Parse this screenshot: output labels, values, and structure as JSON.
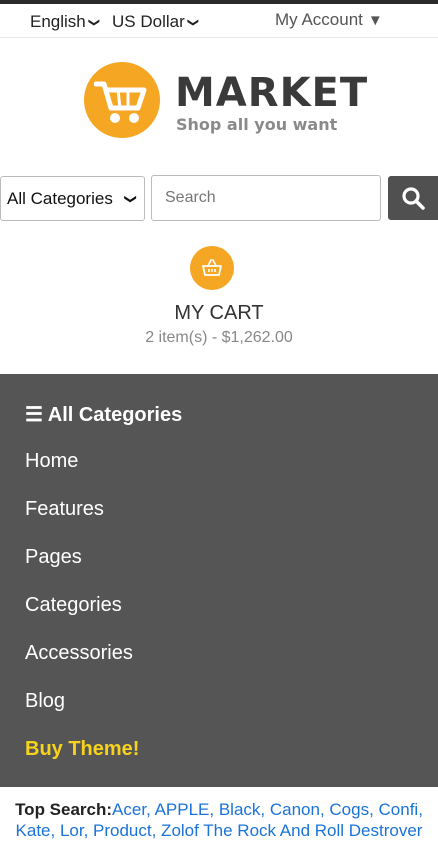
{
  "topbar": {
    "language": "English",
    "currency": "US Dollar",
    "account": "My Account",
    "account_arrow": "▼"
  },
  "logo": {
    "title": "MARKET",
    "tagline": "Shop all you want",
    "icon": "shopping-cart-icon",
    "color": "#f5a623"
  },
  "search": {
    "category": "All Categories",
    "placeholder": "Search",
    "button_icon": "search-icon"
  },
  "cart": {
    "icon": "basket-icon",
    "title": "MY CART",
    "summary": "2 item(s) - $1,262.00"
  },
  "menu": {
    "background": "#555555",
    "header": "☰ All Categories",
    "items": [
      {
        "label": "Home"
      },
      {
        "label": "Features"
      },
      {
        "label": "Pages"
      },
      {
        "label": "Categories"
      },
      {
        "label": "Accessories"
      },
      {
        "label": "Blog"
      }
    ],
    "buy": "Buy Theme!",
    "buy_color": "#f8d21c"
  },
  "top_search": {
    "label": "Top Search:",
    "links": "Acer, APPLE, Black, Canon, Cogs, Confi, Kate, Lor, Product, Zolof The Rock And Roll Destrover"
  }
}
